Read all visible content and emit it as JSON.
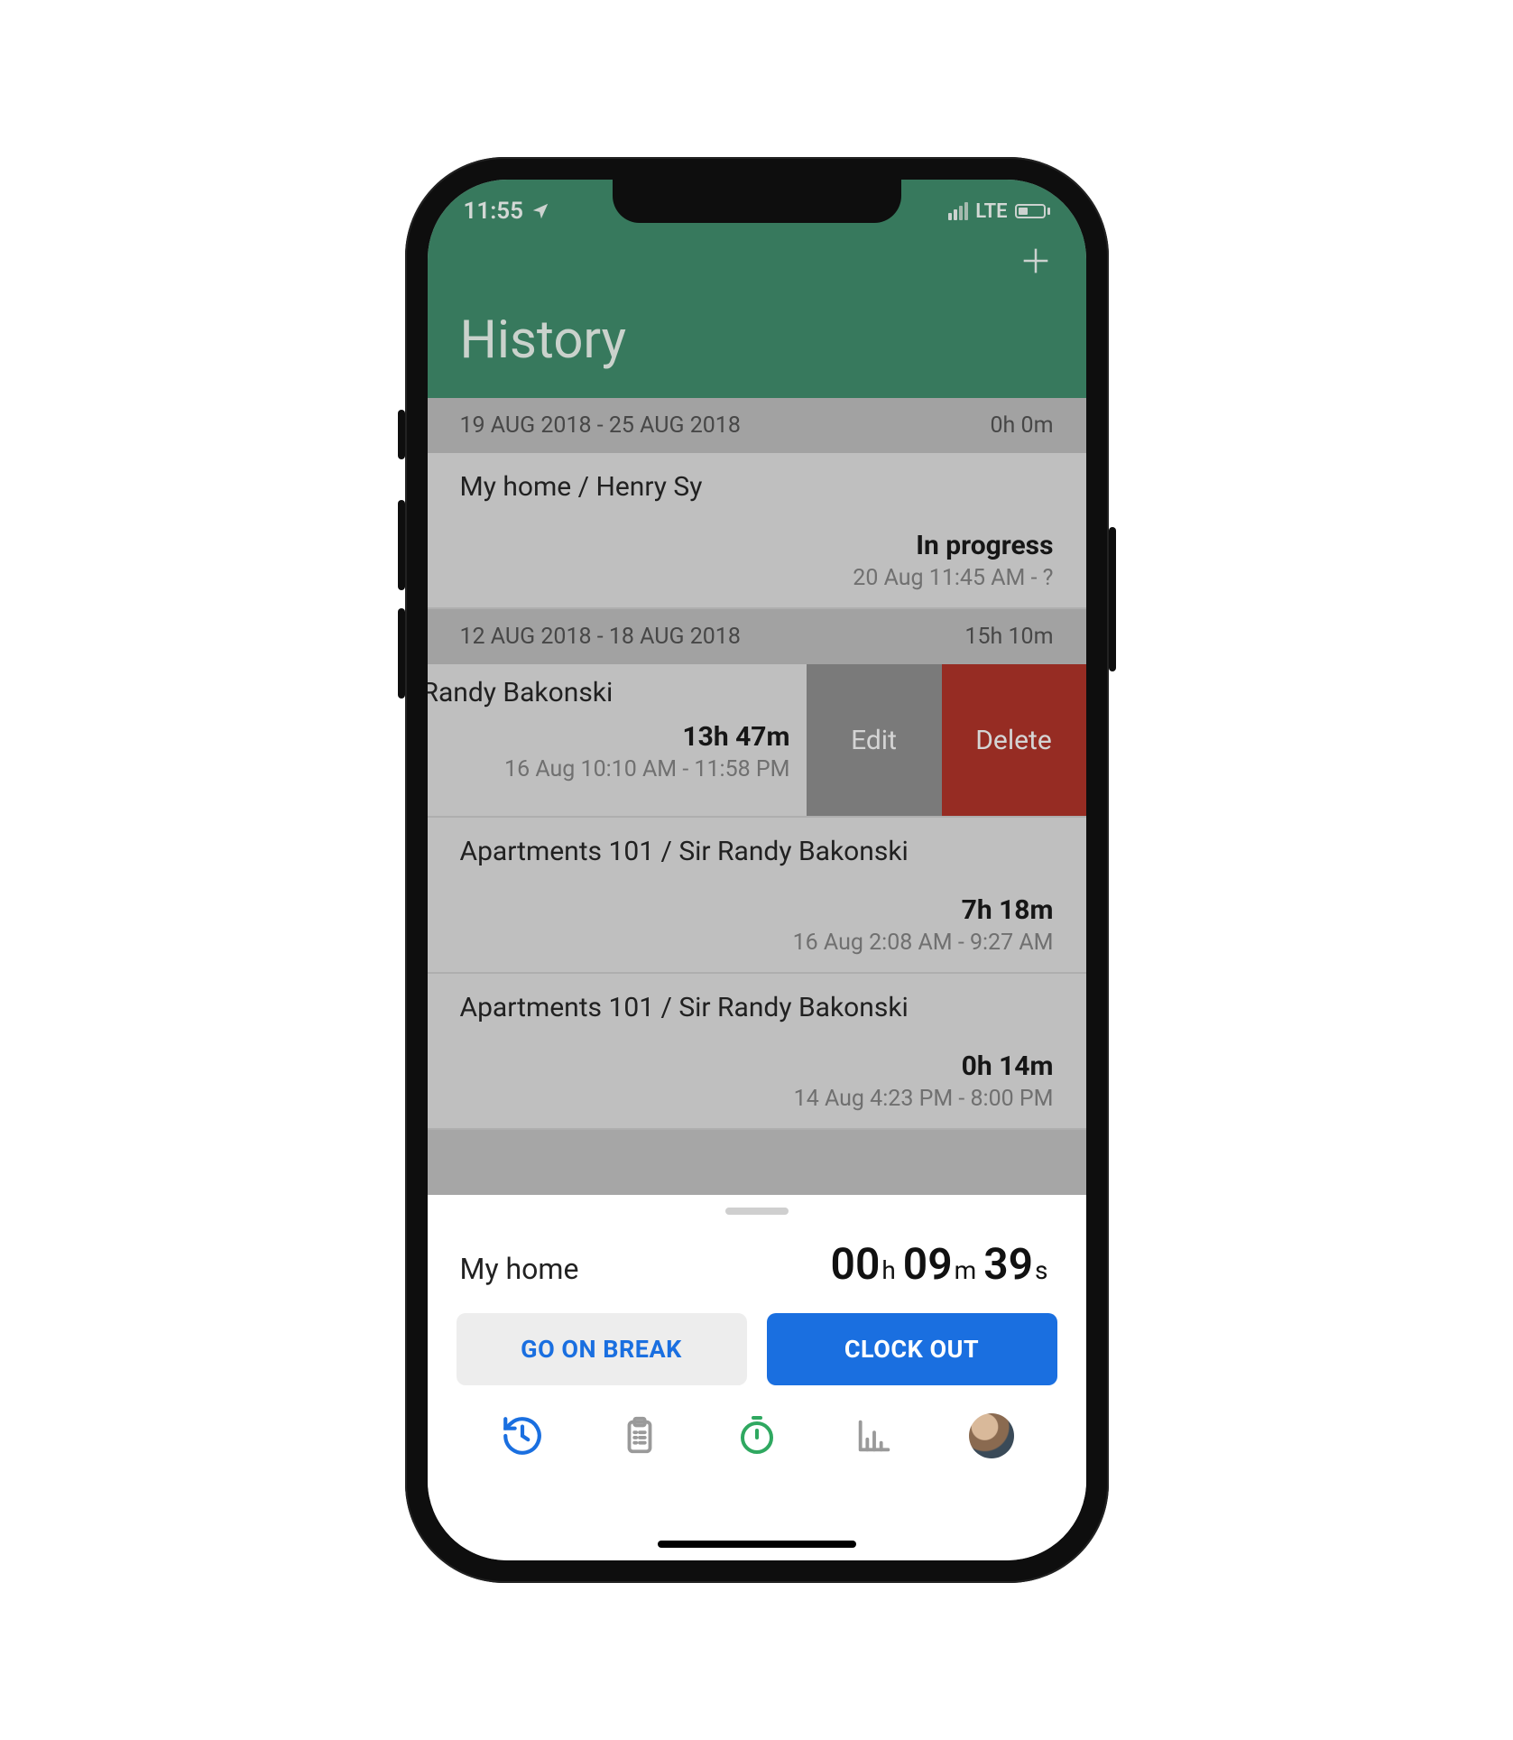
{
  "status_bar": {
    "time": "11:55",
    "network_label": "LTE"
  },
  "header": {
    "title": "History"
  },
  "weeks": [
    {
      "range": "19 AUG 2018 - 25 AUG 2018",
      "total": "0h 0m",
      "entries": [
        {
          "label": "My home / Henry Sy",
          "status": "In progress",
          "sub": "20 Aug 11:45 AM - ?"
        }
      ]
    },
    {
      "range": "12 AUG 2018 - 18 AUG 2018",
      "total": "15h 10m",
      "entries": [
        {
          "label": "Randy Bakonski",
          "status": "13h 47m",
          "sub": "16 Aug 10:10 AM - 11:58 PM",
          "swiped": true,
          "actions": {
            "edit": "Edit",
            "delete": "Delete"
          }
        },
        {
          "label": "Apartments 101 / Sir Randy Bakonski",
          "status": "7h 18m",
          "sub": "16 Aug 2:08 AM - 9:27 AM"
        },
        {
          "label": "Apartments 101 / Sir Randy Bakonski",
          "status": "0h 14m",
          "sub": "14 Aug 4:23 PM - 8:00 PM"
        }
      ]
    }
  ],
  "sheet": {
    "location": "My home",
    "timer": {
      "h": "00",
      "m": "09",
      "s": "39"
    },
    "break_label": "GO ON BREAK",
    "clockout_label": "CLOCK OUT"
  },
  "icons": {
    "location_arrow": "location-arrow-icon",
    "plus": "plus-icon",
    "history": "history-icon",
    "clipboard": "clipboard-icon",
    "stopwatch": "stopwatch-icon",
    "chart": "bar-chart-icon",
    "avatar": "avatar-icon"
  }
}
